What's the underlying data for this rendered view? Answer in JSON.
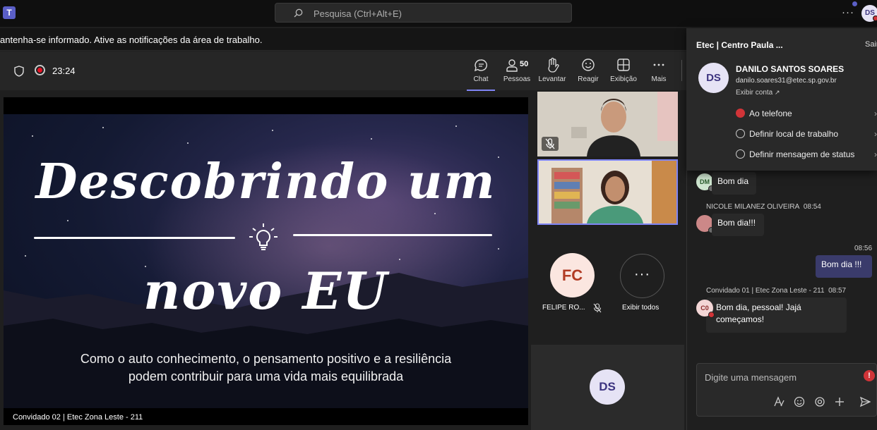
{
  "topbar": {
    "search_placeholder": "Pesquisa (Ctrl+Alt+E)",
    "more_label": "···",
    "avatar_initials": "DS"
  },
  "notification": {
    "text": "antenha-se informado. Ative as notificações da área de trabalho."
  },
  "meeting": {
    "timer": "23:24",
    "toolbar": {
      "chat": "Chat",
      "people": "Pessoas",
      "people_count": "50",
      "raise": "Levantar",
      "react": "Reagir",
      "view": "Exibição",
      "more": "Mais"
    }
  },
  "slide": {
    "title_line1": "Descobrindo um",
    "title_line2": "novo EU",
    "subtitle_line1": "Como o auto conhecimento, o pensamento positivo e a resiliência",
    "subtitle_line2": "podem contribuir para uma vida mais equilibrada",
    "presenter_label": "Convidado 02 | Etec Zona Leste - 211"
  },
  "participants": {
    "fc_initials": "FC",
    "fc_name": "FELIPE RO...",
    "view_all_label": "Exibir todos",
    "view_all_glyph": "···",
    "self_initials": "DS"
  },
  "profile": {
    "org": "Etec | Centro Paula ...",
    "signout": "Sair",
    "initials": "DS",
    "name": "DANILO SANTOS SOARES",
    "email": "danilo.soares31@etec.sp.gov.br",
    "view_account": "Exibir conta",
    "status": "Ao telefone",
    "work_location": "Definir local de trabalho",
    "status_message": "Definir mensagem de status",
    "status_color": "#d13438"
  },
  "chat": {
    "messages": [
      {
        "initials": "DM",
        "text": "Bom dia"
      },
      {
        "author": "NICOLE MILANEZ OLIVEIRA",
        "time": "08:54",
        "text": "Bom dia!!!"
      },
      {
        "time": "08:56",
        "text": "Bom dia !!!"
      },
      {
        "author": "Convidado 01 | Etec Zona Leste - 211",
        "time": "08:57",
        "initials": "C0",
        "text_line1": "Bom dia, pessoal! Jajá",
        "text_line2": "começamos!"
      }
    ],
    "composer_placeholder": "Digite uma mensagem",
    "composer_alert": "!"
  }
}
